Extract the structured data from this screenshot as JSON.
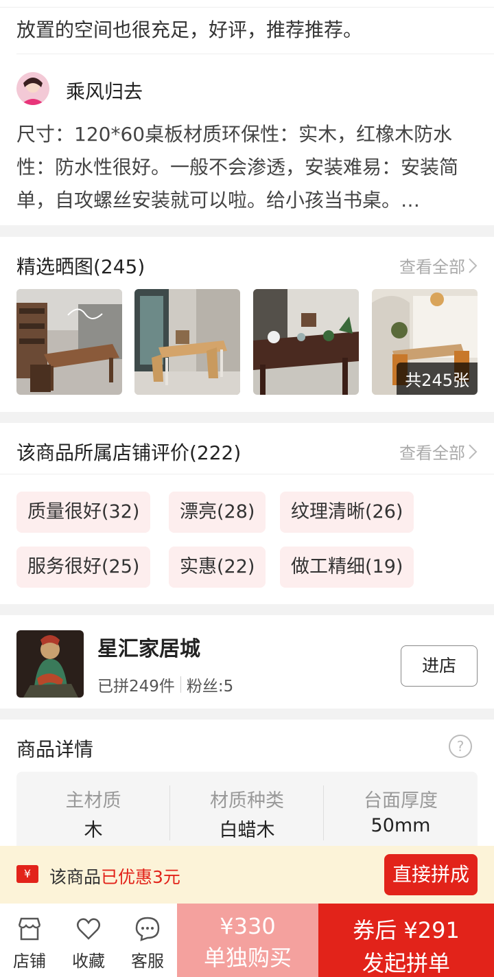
{
  "review": {
    "previous_tail": "放置的空间也很充足，好评，推荐推荐。",
    "reviewer_name": "乘风归去",
    "text": "尺寸：120*60桌板材质环保性：实木，红橡木防水性：防水性很好。一般不会渗透，安装难易：安装简单，自攻螺丝安装就可以啦。给小孩当书桌。…"
  },
  "photos": {
    "title": "精选晒图(245)",
    "see_all": "查看全部",
    "count_badge": "共245张"
  },
  "shop_reviews": {
    "title": "该商品所属店铺评价(222)",
    "see_all": "查看全部",
    "tags": [
      "质量很好(32)",
      "漂亮(28)",
      "纹理清晰(26)",
      "服务很好(25)",
      "实惠(22)",
      "做工精细(19)"
    ]
  },
  "shop": {
    "name": "星汇家居城",
    "sold": "已拼249件",
    "fans": "粉丝:5",
    "enter_label": "进店"
  },
  "details": {
    "title": "商品详情",
    "help": "?",
    "attributes": [
      {
        "label": "主材质",
        "value": "木"
      },
      {
        "label": "材质种类",
        "value": "白蜡木"
      },
      {
        "label": "台面厚度",
        "value": "50mm"
      }
    ]
  },
  "promo": {
    "icon_text": "¥",
    "prefix": "该商品",
    "highlight": "已优惠3元",
    "direct_button": "直接拼成",
    "highlight_color": "#e2231a"
  },
  "bottom_bar": {
    "shop_label": "店铺",
    "favorite_label": "收藏",
    "service_label": "客服",
    "solo_price": "¥330",
    "solo_label": "单独购买",
    "group_price": "券后 ¥291",
    "group_label": "发起拼单",
    "accent": "#e2231a",
    "solo_color": "#f4a19e"
  }
}
